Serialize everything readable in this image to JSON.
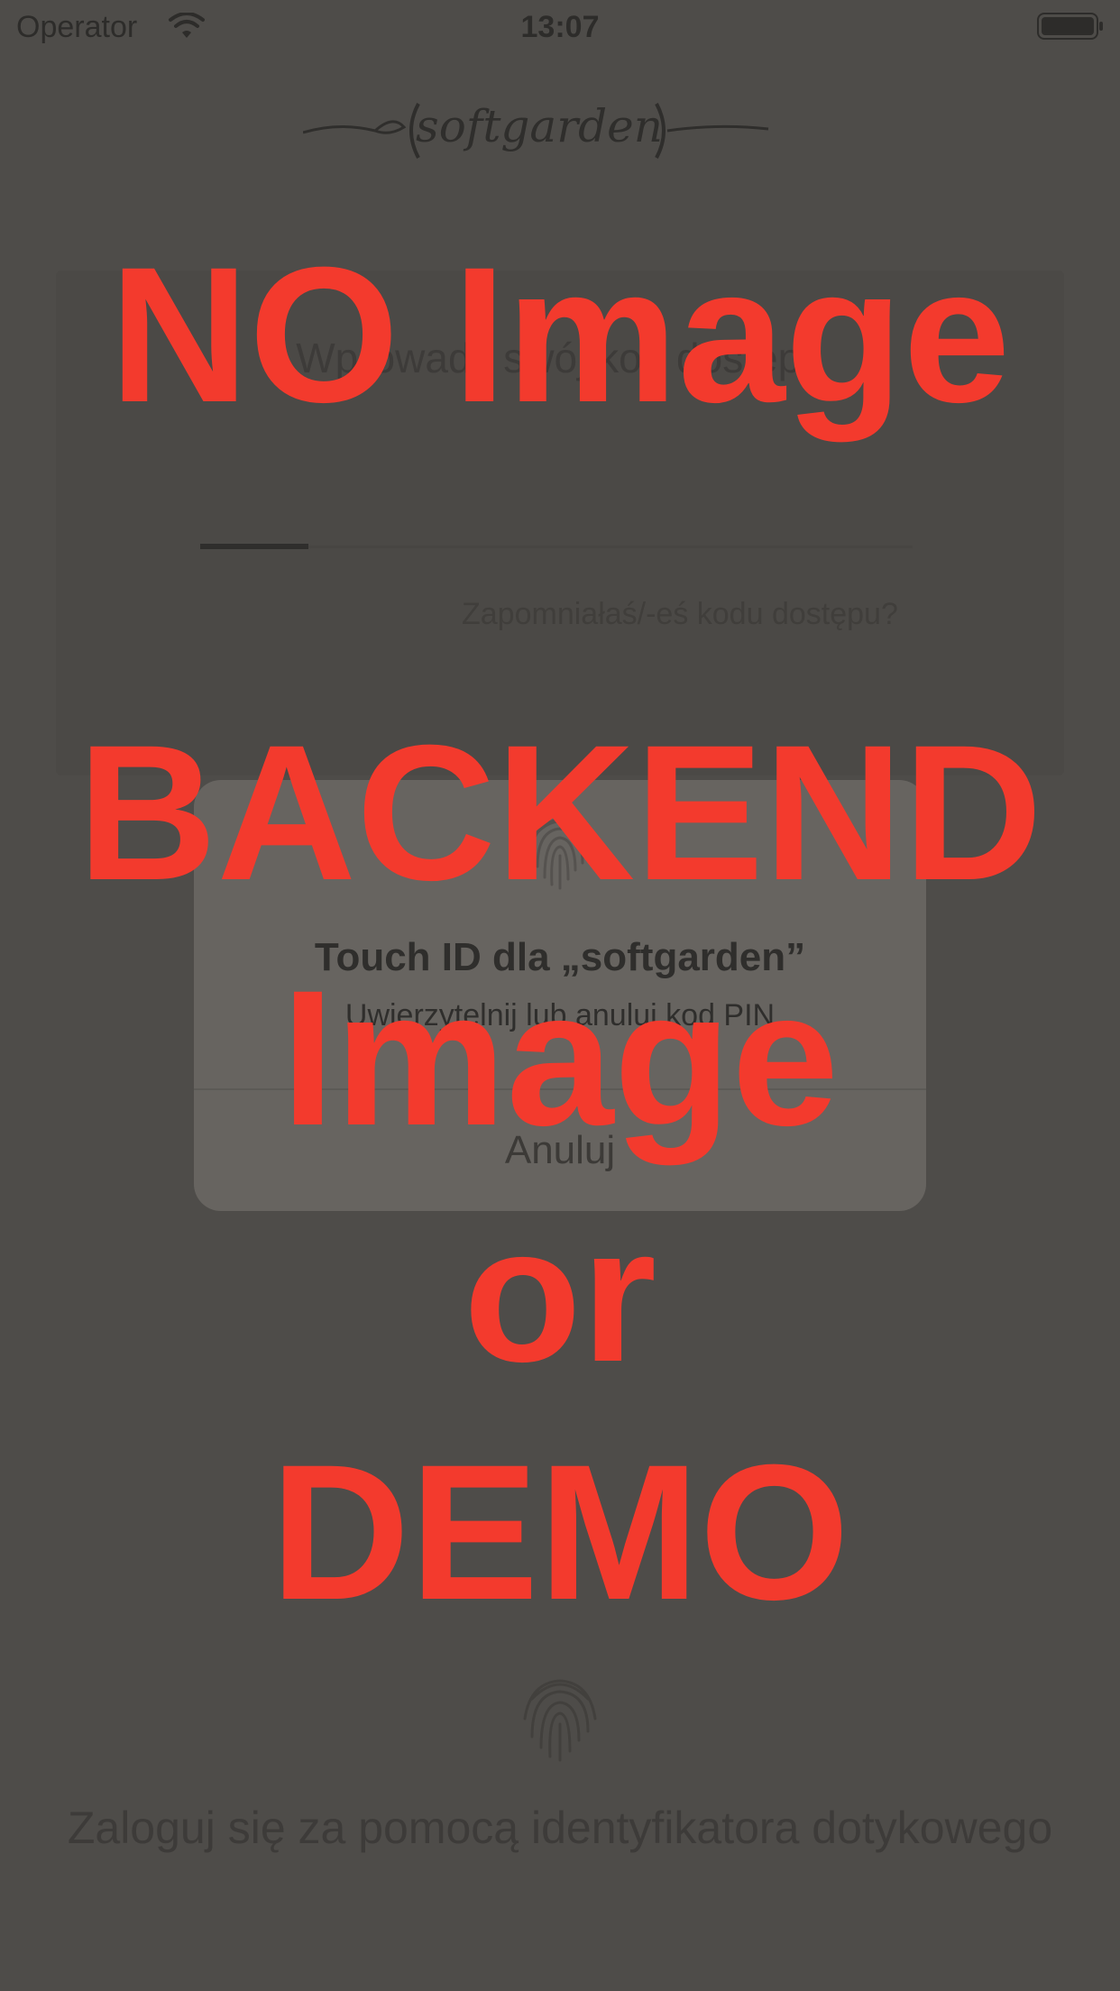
{
  "status_bar": {
    "carrier": "Operator",
    "time": "13:07"
  },
  "logo": {
    "text": "softgarden",
    "icon": "softgarden-logo"
  },
  "pin_screen": {
    "title": "Wprowadź swój kod dostępu",
    "forgot_link": "Zapomniałaś/-eś kodu dostępu?"
  },
  "touch_id_alert": {
    "icon": "fingerprint-icon",
    "title": "Touch ID dla „softgarden”",
    "message": "Uwierzytelnij lub anuluj kod PIN",
    "cancel_label": "Anuluj"
  },
  "touch_login": {
    "icon": "fingerprint-icon",
    "label": "Zaloguj się za pomocą identyfikatora dotykowego"
  },
  "watermark": {
    "line1": "NO Image",
    "line2": "BACKEND",
    "line3": "Image",
    "line4": "or",
    "line5": "DEMO",
    "color": "#f33a2d"
  },
  "colors": {
    "dim_background": "#4e4c49",
    "alert_background": "#676460"
  }
}
